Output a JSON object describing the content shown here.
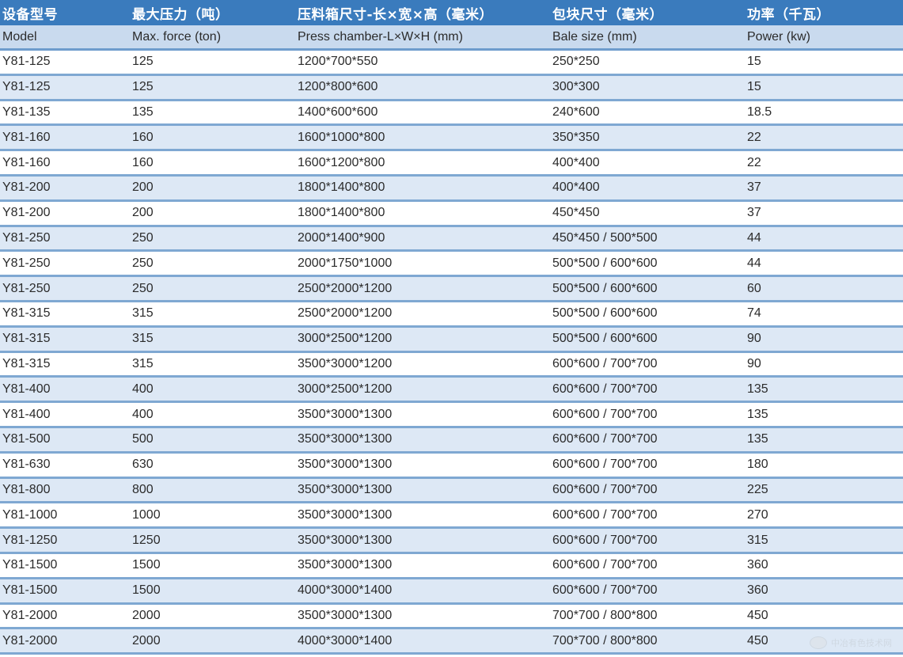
{
  "header_cn": [
    "设备型号",
    "最大压力（吨）",
    "压料箱尺寸-长×宽×高（毫米）",
    "包块尺寸（毫米）",
    "功率（千瓦）"
  ],
  "header_en": [
    "Model",
    "Max. force (ton)",
    "Press chamber-L×W×H (mm)",
    "Bale size (mm)",
    "Power (kw)"
  ],
  "rows": [
    [
      "Y81-125",
      "125",
      "1200*700*550",
      "250*250",
      "15"
    ],
    [
      "Y81-125",
      "125",
      "1200*800*600",
      "300*300",
      "15"
    ],
    [
      "Y81-135",
      "135",
      "1400*600*600",
      "240*600",
      "18.5"
    ],
    [
      "Y81-160",
      "160",
      "1600*1000*800",
      "350*350",
      "22"
    ],
    [
      "Y81-160",
      "160",
      "1600*1200*800",
      "400*400",
      "22"
    ],
    [
      "Y81-200",
      "200",
      "1800*1400*800",
      "400*400",
      "37"
    ],
    [
      "Y81-200",
      "200",
      "1800*1400*800",
      "450*450",
      "37"
    ],
    [
      "Y81-250",
      "250",
      "2000*1400*900",
      "450*450 / 500*500",
      "44"
    ],
    [
      "Y81-250",
      "250",
      "2000*1750*1000",
      "500*500 / 600*600",
      "44"
    ],
    [
      "Y81-250",
      "250",
      "2500*2000*1200",
      "500*500 / 600*600",
      "60"
    ],
    [
      "Y81-315",
      "315",
      "2500*2000*1200",
      "500*500 / 600*600",
      "74"
    ],
    [
      "Y81-315",
      "315",
      "3000*2500*1200",
      "500*500 / 600*600",
      "90"
    ],
    [
      "Y81-315",
      "315",
      "3500*3000*1200",
      "600*600 / 700*700",
      "90"
    ],
    [
      "Y81-400",
      "400",
      "3000*2500*1200",
      "600*600 / 700*700",
      "135"
    ],
    [
      "Y81-400",
      "400",
      "3500*3000*1300",
      "600*600 / 700*700",
      "135"
    ],
    [
      "Y81-500",
      "500",
      "3500*3000*1300",
      "600*600 / 700*700",
      "135"
    ],
    [
      "Y81-630",
      "630",
      "3500*3000*1300",
      "600*600 / 700*700",
      "180"
    ],
    [
      "Y81-800",
      "800",
      "3500*3000*1300",
      "600*600 / 700*700",
      "225"
    ],
    [
      "Y81-1000",
      "1000",
      "3500*3000*1300",
      "600*600 / 700*700",
      "270"
    ],
    [
      "Y81-1250",
      "1250",
      "3500*3000*1300",
      "600*600 / 700*700",
      "315"
    ],
    [
      "Y81-1500",
      "1500",
      "3500*3000*1300",
      "600*600 / 700*700",
      "360"
    ],
    [
      "Y81-1500",
      "1500",
      "4000*3000*1400",
      "600*600 / 700*700",
      "360"
    ],
    [
      "Y81-2000",
      "2000",
      "3500*3000*1300",
      "700*700 / 800*800",
      "450"
    ],
    [
      "Y81-2000",
      "2000",
      "4000*3000*1400",
      "700*700 / 800*800",
      "450"
    ]
  ],
  "watermark": {
    "text": "中冶有色技术网",
    "icon": "company-logo-icon"
  },
  "colors": {
    "header_bg": "#3a7bbd",
    "subheader_bg": "#c9daee",
    "stripe_bg": "#dde8f5",
    "divider": "#7fa8d2"
  }
}
